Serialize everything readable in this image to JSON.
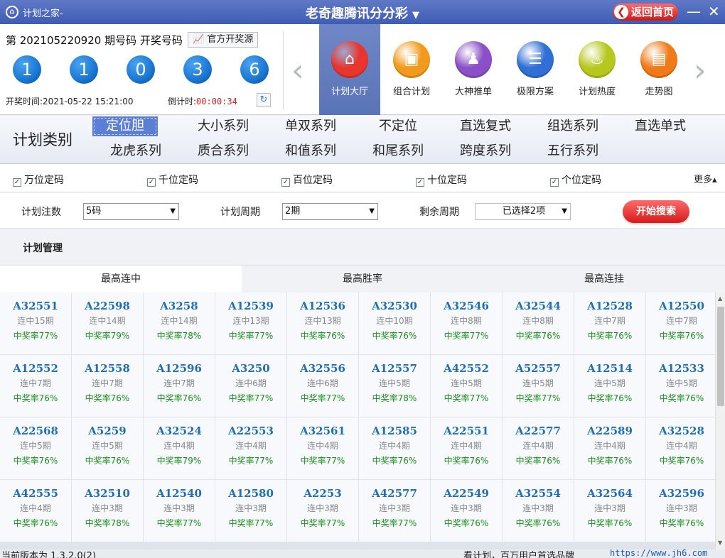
{
  "titlebar": {
    "app_icon": "lock-logo",
    "app_name": "计划之家-",
    "lottery_title": "老奇趣腾讯分分彩",
    "dropdown_glyph": "▼",
    "home_button": "返回首页",
    "minimize_glyph": "—",
    "close_glyph": "✕"
  },
  "draw": {
    "period_text": "第 202105220920 期号码 开奖号码",
    "official_source": "官方开奖源",
    "balls": [
      "1",
      "1",
      "0",
      "3",
      "6"
    ],
    "draw_time_label": "开奖时间:2021-05-22 15:21:00",
    "countdown_label": "倒计时:",
    "countdown_value": "00:00:34",
    "refresh_icon": "refresh-icon"
  },
  "nav": {
    "items": [
      {
        "label": "计划大厅",
        "icon": "home-icon",
        "color": "#e8352e",
        "glyph": "⌂"
      },
      {
        "label": "组合计划",
        "icon": "combine-icon",
        "color": "#f29a1b",
        "glyph": "▣"
      },
      {
        "label": "大神推单",
        "icon": "expert-icon",
        "color": "#8b4fc7",
        "glyph": "♟"
      },
      {
        "label": "极限方案",
        "icon": "layers-icon",
        "color": "#2f6fd6",
        "glyph": "☰"
      },
      {
        "label": "计划热度",
        "icon": "fire-icon",
        "color": "#b6c81e",
        "glyph": "♨"
      },
      {
        "label": "走势图",
        "icon": "trend-icon",
        "color": "#f07a18",
        "glyph": "▤"
      }
    ],
    "prev_glyph": "‹",
    "next_glyph": "›"
  },
  "category": {
    "title": "计划类别",
    "row1": [
      "定位胆",
      "大小系列",
      "单双系列",
      "不定位",
      "直选复式",
      "组选系列",
      "直选单式"
    ],
    "row2": [
      "龙虎系列",
      "质合系列",
      "和值系列",
      "和尾系列",
      "跨度系列",
      "五行系列"
    ]
  },
  "positions": {
    "checkboxes": [
      "万位定码",
      "千位定码",
      "百位定码",
      "十位定码",
      "个位定码"
    ],
    "check_glyph": "✓",
    "more": "更多▴"
  },
  "settings": {
    "bets_label": "计划注数",
    "bets_value": "5码",
    "period_label": "计划周期",
    "period_value": "2期",
    "remaining_label": "剩余周期",
    "remaining_value": "已选择2项",
    "search_button": "开始搜索"
  },
  "management": {
    "title": "计划管理",
    "tabs": [
      "最高连中",
      "最高胜率",
      "最高连挂"
    ],
    "active_tab": 0
  },
  "plans": [
    [
      {
        "code": "A32551",
        "streak": "连中15期",
        "rate": "中奖率77%"
      },
      {
        "code": "A22598",
        "streak": "连中14期",
        "rate": "中奖率79%"
      },
      {
        "code": "A3258",
        "streak": "连中14期",
        "rate": "中奖率78%"
      },
      {
        "code": "A12539",
        "streak": "连中13期",
        "rate": "中奖率77%"
      },
      {
        "code": "A12536",
        "streak": "连中13期",
        "rate": "中奖率76%"
      },
      {
        "code": "A32530",
        "streak": "连中10期",
        "rate": "中奖率76%"
      },
      {
        "code": "A32546",
        "streak": "连中8期",
        "rate": "中奖率77%"
      },
      {
        "code": "A32544",
        "streak": "连中8期",
        "rate": "中奖率76%"
      },
      {
        "code": "A12528",
        "streak": "连中7期",
        "rate": "中奖率76%"
      },
      {
        "code": "A12550",
        "streak": "连中7期",
        "rate": "中奖率76%"
      }
    ],
    [
      {
        "code": "A12552",
        "streak": "连中7期",
        "rate": "中奖率76%"
      },
      {
        "code": "A12558",
        "streak": "连中7期",
        "rate": "中奖率76%"
      },
      {
        "code": "A12596",
        "streak": "连中7期",
        "rate": "中奖率76%"
      },
      {
        "code": "A3250",
        "streak": "连中6期",
        "rate": "中奖率77%"
      },
      {
        "code": "A32556",
        "streak": "连中6期",
        "rate": "中奖率77%"
      },
      {
        "code": "A12557",
        "streak": "连中5期",
        "rate": "中奖率78%"
      },
      {
        "code": "A42552",
        "streak": "连中5期",
        "rate": "中奖率77%"
      },
      {
        "code": "A52557",
        "streak": "连中5期",
        "rate": "中奖率77%"
      },
      {
        "code": "A12514",
        "streak": "连中5期",
        "rate": "中奖率76%"
      },
      {
        "code": "A12533",
        "streak": "连中5期",
        "rate": "中奖率76%"
      }
    ],
    [
      {
        "code": "A22568",
        "streak": "连中5期",
        "rate": "中奖率76%"
      },
      {
        "code": "A5259",
        "streak": "连中5期",
        "rate": "中奖率76%"
      },
      {
        "code": "A32524",
        "streak": "连中4期",
        "rate": "中奖率79%"
      },
      {
        "code": "A22553",
        "streak": "连中4期",
        "rate": "中奖率77%"
      },
      {
        "code": "A32561",
        "streak": "连中4期",
        "rate": "中奖率77%"
      },
      {
        "code": "A12585",
        "streak": "连中4期",
        "rate": "中奖率76%"
      },
      {
        "code": "A22551",
        "streak": "连中4期",
        "rate": "中奖率76%"
      },
      {
        "code": "A22577",
        "streak": "连中4期",
        "rate": "中奖率76%"
      },
      {
        "code": "A22589",
        "streak": "连中4期",
        "rate": "中奖率76%"
      },
      {
        "code": "A32528",
        "streak": "连中4期",
        "rate": "中奖率76%"
      }
    ],
    [
      {
        "code": "A42555",
        "streak": "连中4期",
        "rate": "中奖率76%"
      },
      {
        "code": "A32510",
        "streak": "连中3期",
        "rate": "中奖率78%"
      },
      {
        "code": "A12540",
        "streak": "连中3期",
        "rate": "中奖率77%"
      },
      {
        "code": "A12580",
        "streak": "连中3期",
        "rate": "中奖率77%"
      },
      {
        "code": "A2253",
        "streak": "连中3期",
        "rate": "中奖率77%"
      },
      {
        "code": "A42577",
        "streak": "连中3期",
        "rate": "中奖率77%"
      },
      {
        "code": "A22549",
        "streak": "连中3期",
        "rate": "中奖率76%"
      },
      {
        "code": "A32554",
        "streak": "连中3期",
        "rate": "中奖率76%"
      },
      {
        "code": "A32564",
        "streak": "连中3期",
        "rate": "中奖率76%"
      },
      {
        "code": "A32596",
        "streak": "连中3期",
        "rate": "中奖率76%"
      }
    ]
  ],
  "status": {
    "version": "当前版本为 1.3.2.0(2)",
    "slogan": "看计划，百万用户首选品牌",
    "url": "https://www.jh6.com"
  },
  "colors": {
    "title_bar": "#4a66bb",
    "accent_blue": "#1f6fb5",
    "rate_green": "#189018",
    "countdown_red": "#e02020",
    "button_red": "#d51a1a"
  }
}
